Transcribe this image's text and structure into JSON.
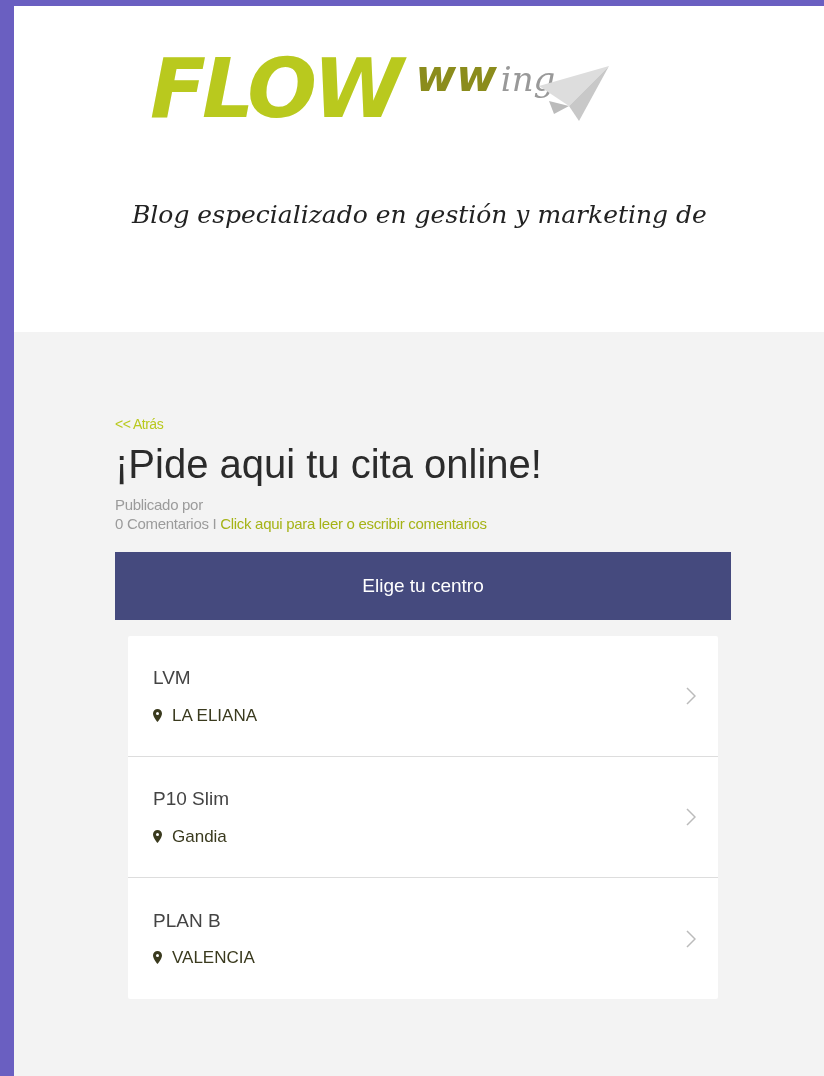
{
  "logo": {
    "main": "FLOW",
    "trail": "ww",
    "script": "ing"
  },
  "tagline": "Blog especializado en gestión y marketing de",
  "back_link": "<< Atrás",
  "title": "¡Pide aqui tu cita online!",
  "byline": "Publicado por",
  "comments": {
    "count": "0 Comentarios I",
    "link": "Click aqui para leer o escribir comentarios"
  },
  "panel": {
    "heading": "Elige tu centro",
    "centers": [
      {
        "name": "LVM",
        "location": "LA ELIANA"
      },
      {
        "name": "P10 Slim",
        "location": "Gandia"
      },
      {
        "name": "PLAN B",
        "location": "VALENCIA"
      }
    ]
  }
}
